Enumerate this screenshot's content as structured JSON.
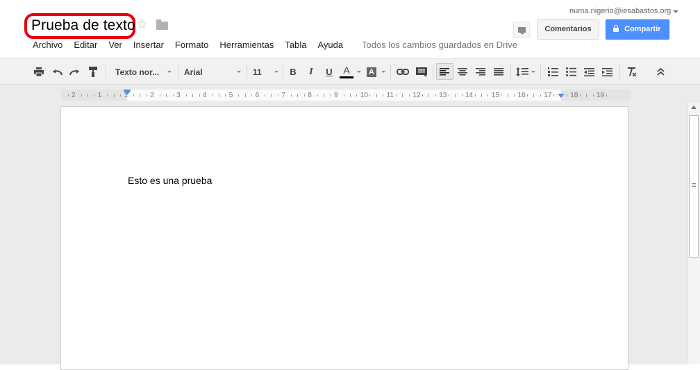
{
  "document": {
    "title": "Prueba de texto",
    "body_text": "Esto es una prueba"
  },
  "header": {
    "account_email": "numa.nigerio@iesabastos.org",
    "comments_label": "Comentarios",
    "share_label": "Compartir",
    "save_status": "Todos los cambios guardados en Drive"
  },
  "menu": [
    {
      "label": "Archivo"
    },
    {
      "label": "Editar"
    },
    {
      "label": "Ver"
    },
    {
      "label": "Insertar"
    },
    {
      "label": "Formato"
    },
    {
      "label": "Herramientas"
    },
    {
      "label": "Tabla"
    },
    {
      "label": "Ayuda"
    }
  ],
  "toolbar": {
    "style_value": "Texto nor...",
    "font_value": "Arial",
    "size_value": "11",
    "bold_glyph": "B",
    "italic_glyph": "I",
    "underline_glyph": "U",
    "text_color_glyph": "A",
    "highlight_glyph": "A",
    "icons": [
      "print-icon",
      "undo-icon",
      "redo-icon",
      "paint-format-icon",
      "link-icon",
      "comment-add-icon",
      "align-left-icon",
      "align-center-icon",
      "align-right-icon",
      "align-justify-icon",
      "line-spacing-icon",
      "numbered-list-icon",
      "bulleted-list-icon",
      "decrease-indent-icon",
      "increase-indent-icon",
      "clear-formatting-icon",
      "collapse-icon"
    ],
    "active_alignment": "left"
  },
  "ruler": {
    "labels": [
      "2",
      "1",
      "1",
      "2",
      "3",
      "4",
      "5",
      "6",
      "7",
      "8",
      "9",
      "10",
      "11",
      "12",
      "13",
      "14",
      "15",
      "16",
      "17",
      "18",
      "19"
    ]
  },
  "colors": {
    "share_button": "#4d90fe",
    "title_highlight": "#e5000b",
    "indent_marker": "#5a8ce8"
  }
}
